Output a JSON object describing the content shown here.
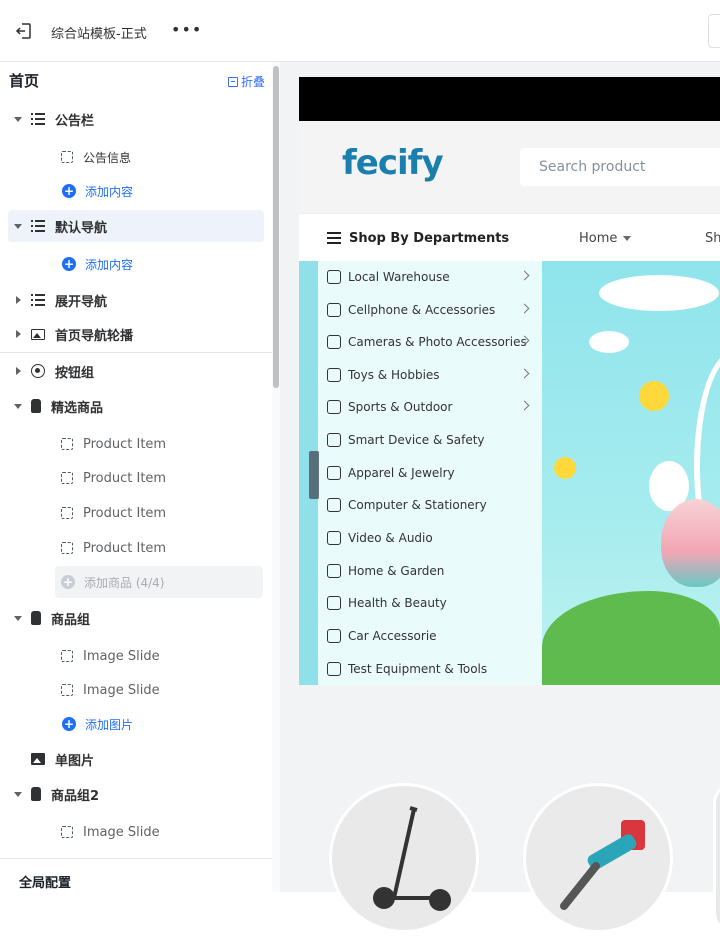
{
  "topbar": {
    "title": "综合站模板-正式",
    "more": "•••"
  },
  "sidebar": {
    "heading": "首页",
    "collapse_label": "折叠",
    "items": [
      {
        "label": "公告栏"
      },
      {
        "label": "公告信息"
      },
      {
        "label": "添加内容"
      },
      {
        "label": "默认导航"
      },
      {
        "label": "添加内容"
      },
      {
        "label": "展开导航"
      },
      {
        "label": "首页导航轮播"
      },
      {
        "label": "按钮组"
      },
      {
        "label": "精选商品"
      },
      {
        "label": "Product Item"
      },
      {
        "label": "Product Item"
      },
      {
        "label": "Product Item"
      },
      {
        "label": "Product Item"
      },
      {
        "label": "添加商品 (4/4)"
      },
      {
        "label": "商品组"
      },
      {
        "label": "Image Slide"
      },
      {
        "label": "Image Slide"
      },
      {
        "label": "添加图片"
      },
      {
        "label": "单图片"
      },
      {
        "label": "商品组2"
      },
      {
        "label": "Image Slide"
      }
    ],
    "global_config": "全局配置"
  },
  "preview": {
    "logo": "fecify",
    "search_placeholder": "Search product",
    "shop_by": "Shop By Departments",
    "nav_home": "Home",
    "nav_sh": "Sh",
    "departments": [
      "Local Warehouse",
      "Cellphone & Accessories",
      "Cameras & Photo Accessories",
      "Toys & Hobbies",
      "Sports & Outdoor",
      "Smart Device & Safety",
      "Apparel & Jewelry",
      "Computer & Stationery",
      "Video & Audio",
      "Home & Garden",
      "Health & Beauty",
      "Car Accessorie",
      "Test Equipment & Tools"
    ]
  },
  "colors": {
    "accent": "#1f6ff5",
    "brand": "#1b7fae",
    "banner": "#8fe0e8"
  }
}
